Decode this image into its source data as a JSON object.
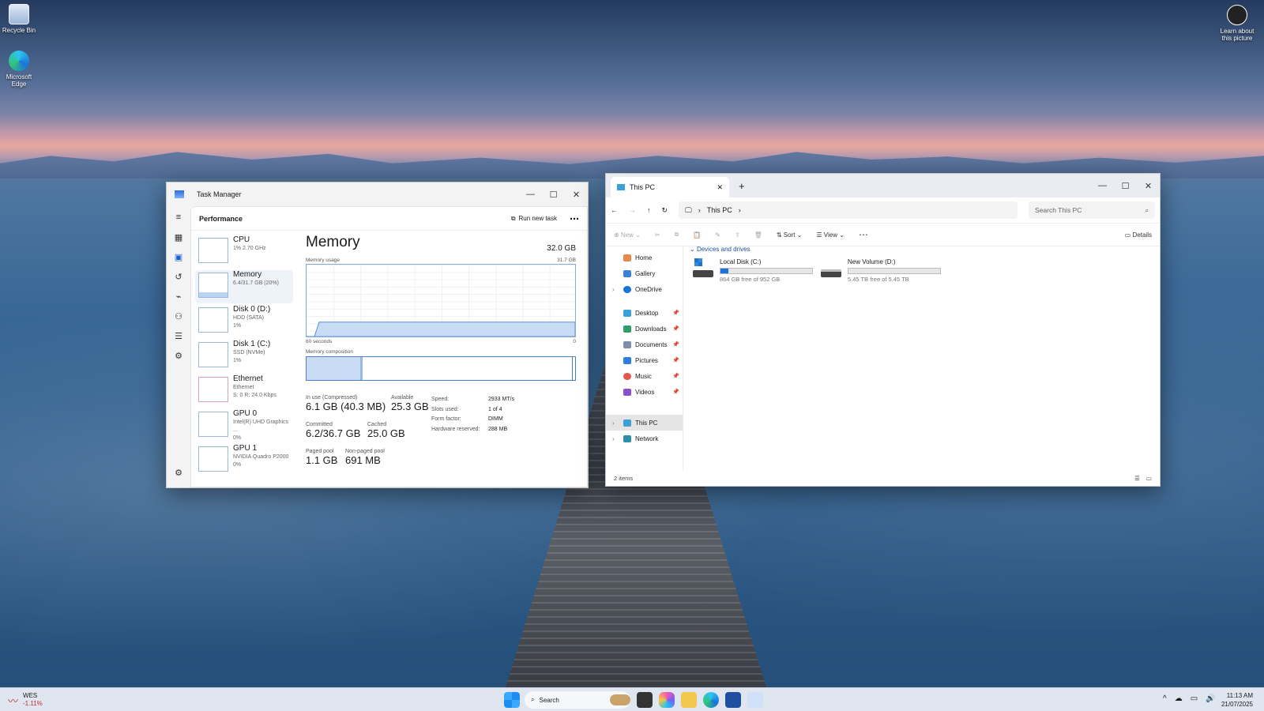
{
  "desktop": {
    "icons": [
      {
        "label": "Recycle Bin"
      },
      {
        "label": "Microsoft Edge"
      }
    ],
    "spotlight": "Learn about this picture"
  },
  "task_manager": {
    "title": "Task Manager",
    "section": "Performance",
    "run_new_task": "Run new task",
    "devices": [
      {
        "name": "CPU",
        "sub": "1% 2.70 GHz",
        "sub2": ""
      },
      {
        "name": "Memory",
        "sub": "6.4/31.7 GB (20%)",
        "sub2": ""
      },
      {
        "name": "Disk 0 (D:)",
        "sub": "HDD (SATA)",
        "sub2": "1%"
      },
      {
        "name": "Disk 1 (C:)",
        "sub": "SSD (NVMe)",
        "sub2": "1%"
      },
      {
        "name": "Ethernet",
        "sub": "Ethernet",
        "sub2": "S: 0 R: 24.0 Kbps"
      },
      {
        "name": "GPU 0",
        "sub": "Intel(R) UHD Graphics ...",
        "sub2": "0%"
      },
      {
        "name": "GPU 1",
        "sub": "NVIDIA Quadro P2000",
        "sub2": "0%"
      }
    ],
    "memory": {
      "title": "Memory",
      "total": "32.0 GB",
      "usage_label": "Memory usage",
      "usage_max": "31.7 GB",
      "x_left": "60 seconds",
      "x_right": "0",
      "usage_fraction": 0.2,
      "composition_label": "Memory composition",
      "stats": {
        "in_use_label": "In use (Compressed)",
        "in_use": "6.1 GB (40.3 MB)",
        "available_label": "Available",
        "available": "25.3 GB",
        "committed_label": "Committed",
        "committed": "6.2/36.7 GB",
        "cached_label": "Cached",
        "cached": "25.0 GB",
        "paged_label": "Paged pool",
        "paged": "1.1 GB",
        "nonpaged_label": "Non-paged pool",
        "nonpaged": "691 MB"
      },
      "details": [
        {
          "k": "Speed:",
          "v": "2933 MT/s"
        },
        {
          "k": "Slots used:",
          "v": "1 of 4"
        },
        {
          "k": "Form factor:",
          "v": "DIMM"
        },
        {
          "k": "Hardware reserved:",
          "v": "288 MB"
        }
      ]
    }
  },
  "explorer": {
    "tab_title": "This PC",
    "address": "This PC",
    "search_placeholder": "Search This PC",
    "toolbar": {
      "new": "New",
      "sort": "Sort",
      "view": "View",
      "details": "Details"
    },
    "nav": {
      "home": "Home",
      "gallery": "Gallery",
      "onedrive": "OneDrive",
      "desktop": "Desktop",
      "downloads": "Downloads",
      "documents": "Documents",
      "pictures": "Pictures",
      "music": "Music",
      "videos": "Videos",
      "thispc": "This PC",
      "network": "Network"
    },
    "group": "Devices and drives",
    "drives": [
      {
        "name": "Local Disk (C:)",
        "free": "864 GB free of 952 GB",
        "used_fraction": 0.09
      },
      {
        "name": "New Volume (D:)",
        "free": "5.45 TB free of 5.45 TB",
        "used_fraction": 0.0
      }
    ],
    "status": "2 items"
  },
  "taskbar": {
    "weather_label": "WES",
    "weather_value": "-1.11%",
    "search": "Search",
    "time": "11:13 AM",
    "date": "21/07/2025"
  }
}
